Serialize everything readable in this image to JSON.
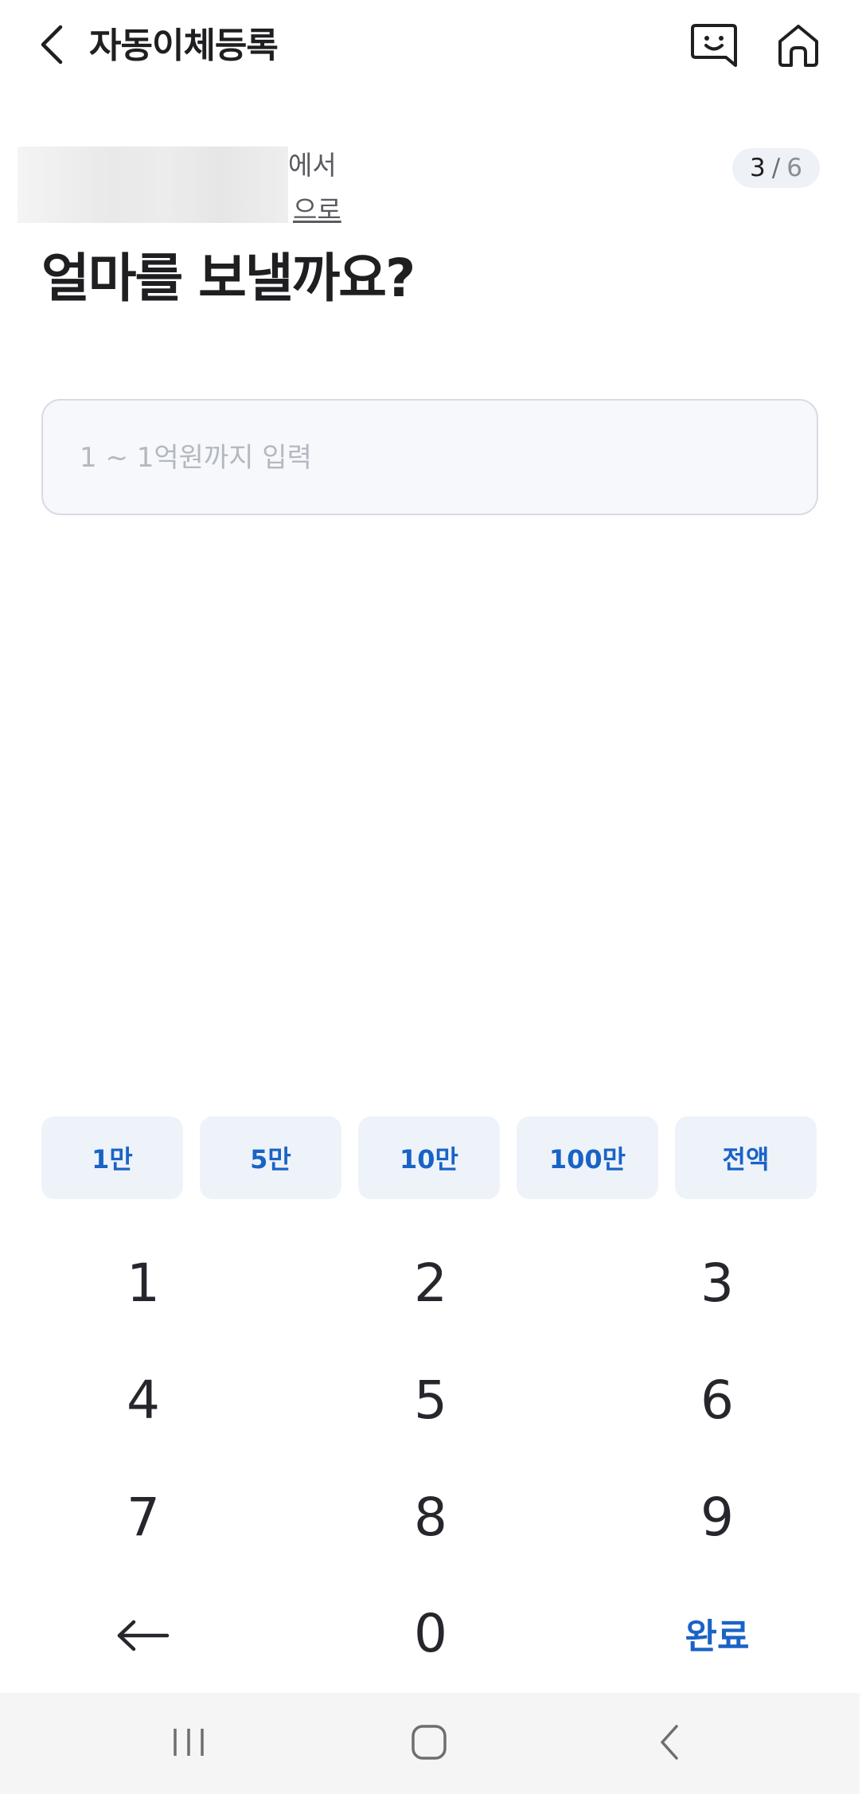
{
  "header": {
    "title": "자동이체등록",
    "back_icon": "chevron-left-icon",
    "chat_icon": "chat-face-icon",
    "home_icon": "home-icon"
  },
  "account": {
    "from_suffix": "에서",
    "to_suffix": "으로"
  },
  "step": {
    "current": "3",
    "separator": "/",
    "total": "6"
  },
  "question": "얼마를 보낼까요?",
  "amount_input": {
    "value": "",
    "placeholder": "1 ~ 1억원까지 입력"
  },
  "quick_amounts": [
    "1만",
    "5만",
    "10만",
    "100만",
    "전액"
  ],
  "keypad": {
    "keys": [
      "1",
      "2",
      "3",
      "4",
      "5",
      "6",
      "7",
      "8",
      "9"
    ],
    "zero": "0",
    "backspace_icon": "arrow-left-icon",
    "done": "완료"
  },
  "navbar": {
    "recent_icon": "recent-apps-icon",
    "home_icon": "home-square-icon",
    "back_icon": "back-chevron-icon"
  },
  "colors": {
    "accent": "#1a63c6",
    "chip_bg": "#eef3fa",
    "input_bg": "#f6f8fb",
    "nav_bg": "#f5f5f5"
  }
}
